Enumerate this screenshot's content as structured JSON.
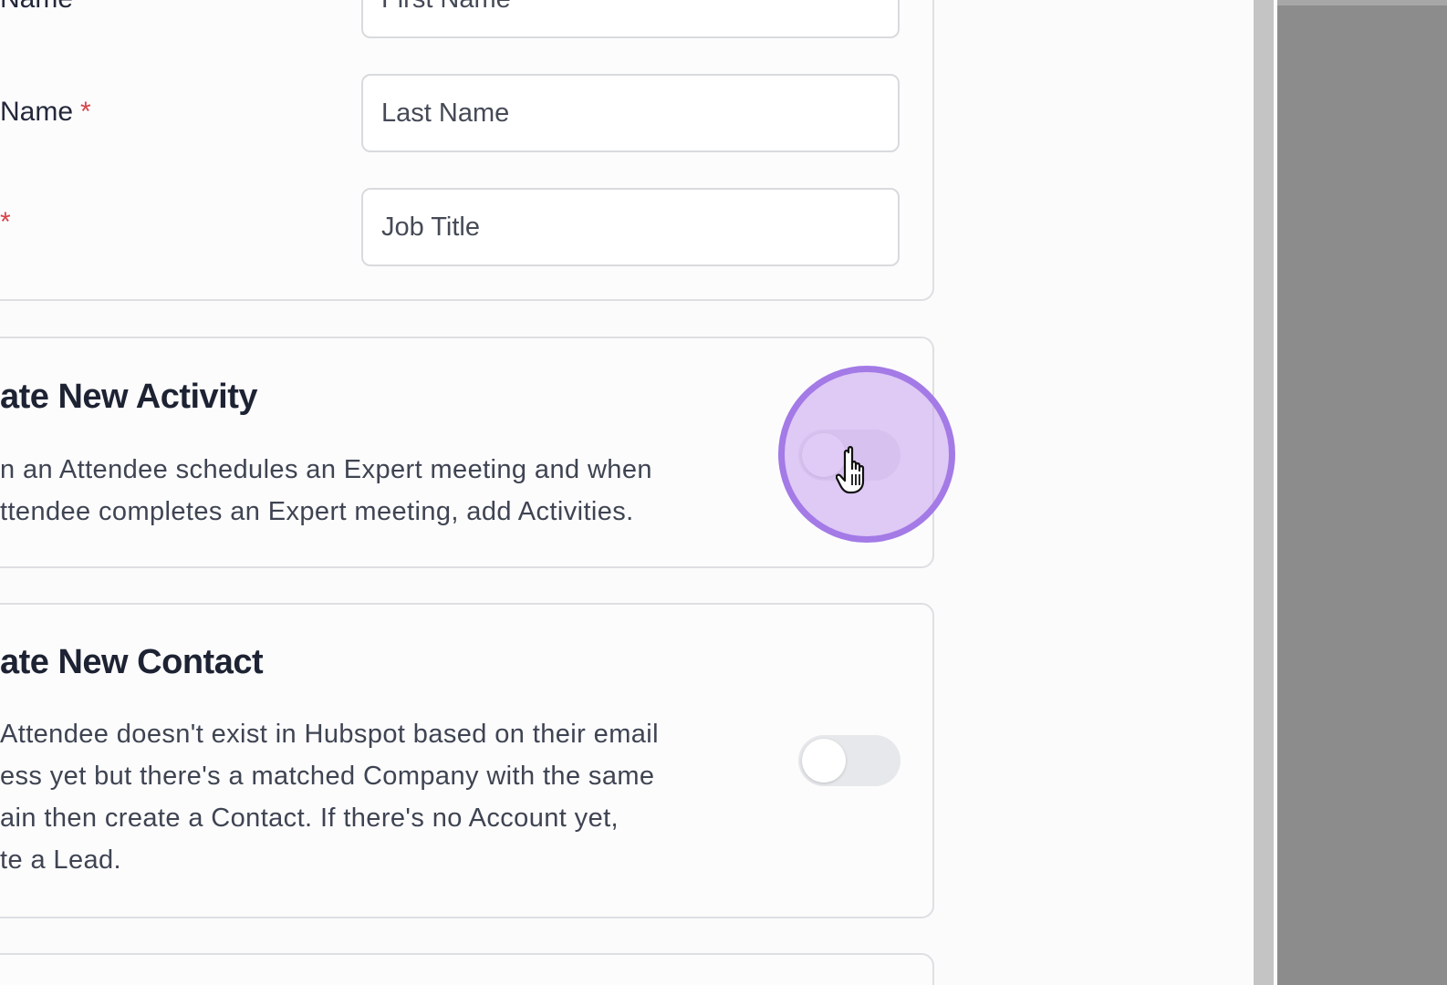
{
  "form": {
    "first_name": {
      "label": "Name",
      "placeholder": "First Name"
    },
    "last_name": {
      "label": "Name",
      "required_marker": "*",
      "placeholder": "Last Name"
    },
    "job_title": {
      "label": "",
      "required_marker": "*",
      "placeholder": "Job Title"
    }
  },
  "activity_section": {
    "title": "ate New Activity",
    "description": "n an Attendee schedules an Expert meeting and when\nttendee completes an Expert meeting, add Activities.",
    "toggle_on": false
  },
  "contact_section": {
    "title": "ate New Contact",
    "description": "Attendee doesn't exist in Hubspot based on their email\ness yet but there's a matched Company with the same\nain then create a Contact. If there's no Account yet,\nte a Lead.",
    "toggle_on": false
  },
  "colors": {
    "required": "#d8434a",
    "click_highlight": "#a37ae6",
    "toggle_off": "#e7e8eb"
  },
  "icons": {
    "cursor": "hand-pointer-icon"
  }
}
